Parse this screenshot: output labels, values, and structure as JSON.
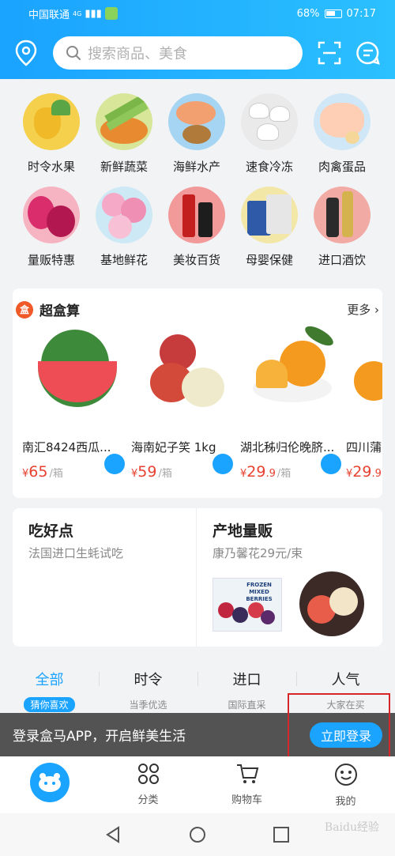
{
  "status_bar": {
    "carrier": "中国联通",
    "network": "4G",
    "battery": "68%",
    "time": "07:17"
  },
  "search": {
    "placeholder": "搜索商品、美食"
  },
  "categories": [
    {
      "label": "时令水果",
      "color": "#f7d35a"
    },
    {
      "label": "新鲜蔬菜",
      "color": "#c6e08a"
    },
    {
      "label": "海鲜水产",
      "color": "#8dc9ef"
    },
    {
      "label": "速食冷冻",
      "color": "#e6e6e6"
    },
    {
      "label": "肉禽蛋品",
      "color": "#ffd0b8"
    },
    {
      "label": "量贩特惠",
      "color": "#f89bb3"
    },
    {
      "label": "基地鲜花",
      "color": "#f6a9c7"
    },
    {
      "label": "美妆百货",
      "color": "#e94444"
    },
    {
      "label": "母婴保健",
      "color": "#f7e08c"
    },
    {
      "label": "进口酒饮",
      "color": "#f2a7a2"
    }
  ],
  "superbox": {
    "title": "超盒算",
    "logo": "盒",
    "more": "更多",
    "products": [
      {
        "name": "南汇8424西瓜...",
        "price": "65",
        "decimal": "",
        "unit": "/箱"
      },
      {
        "name": "海南妃子笑 1kg",
        "price": "59",
        "decimal": "",
        "unit": "/箱"
      },
      {
        "name": "湖北秭归伦晚脐...",
        "price": "29",
        "decimal": ".9",
        "unit": "/箱"
      },
      {
        "name": "四川蒲",
        "price": "29",
        "decimal": ".9",
        "unit": "/"
      }
    ],
    "currency": "¥"
  },
  "promo": {
    "left": {
      "title": "吃好点",
      "subtitle": "法国进口生蚝试吃"
    },
    "right": {
      "title": "产地量贩",
      "subtitle": "康乃馨花29元/束",
      "package_text": "FROZEN MIXED BERRIES"
    }
  },
  "tabs": [
    {
      "title": "全部",
      "sub": "猜你喜欢",
      "active": true
    },
    {
      "title": "时令",
      "sub": "当季优选",
      "active": false
    },
    {
      "title": "进口",
      "sub": "国际直采",
      "active": false
    },
    {
      "title": "人气",
      "sub": "大家在买",
      "active": false
    }
  ],
  "login_bar": {
    "text": "登录盒马APP，开启鲜美生活",
    "button": "立即登录"
  },
  "bottom_nav": [
    {
      "label": ""
    },
    {
      "label": "分类"
    },
    {
      "label": "购物车"
    },
    {
      "label": "我的"
    }
  ],
  "watermark": "Baidu经验",
  "colors": {
    "accent": "#1aa3ff",
    "price": "#e9412f",
    "highlight_box": "#d6262a"
  }
}
